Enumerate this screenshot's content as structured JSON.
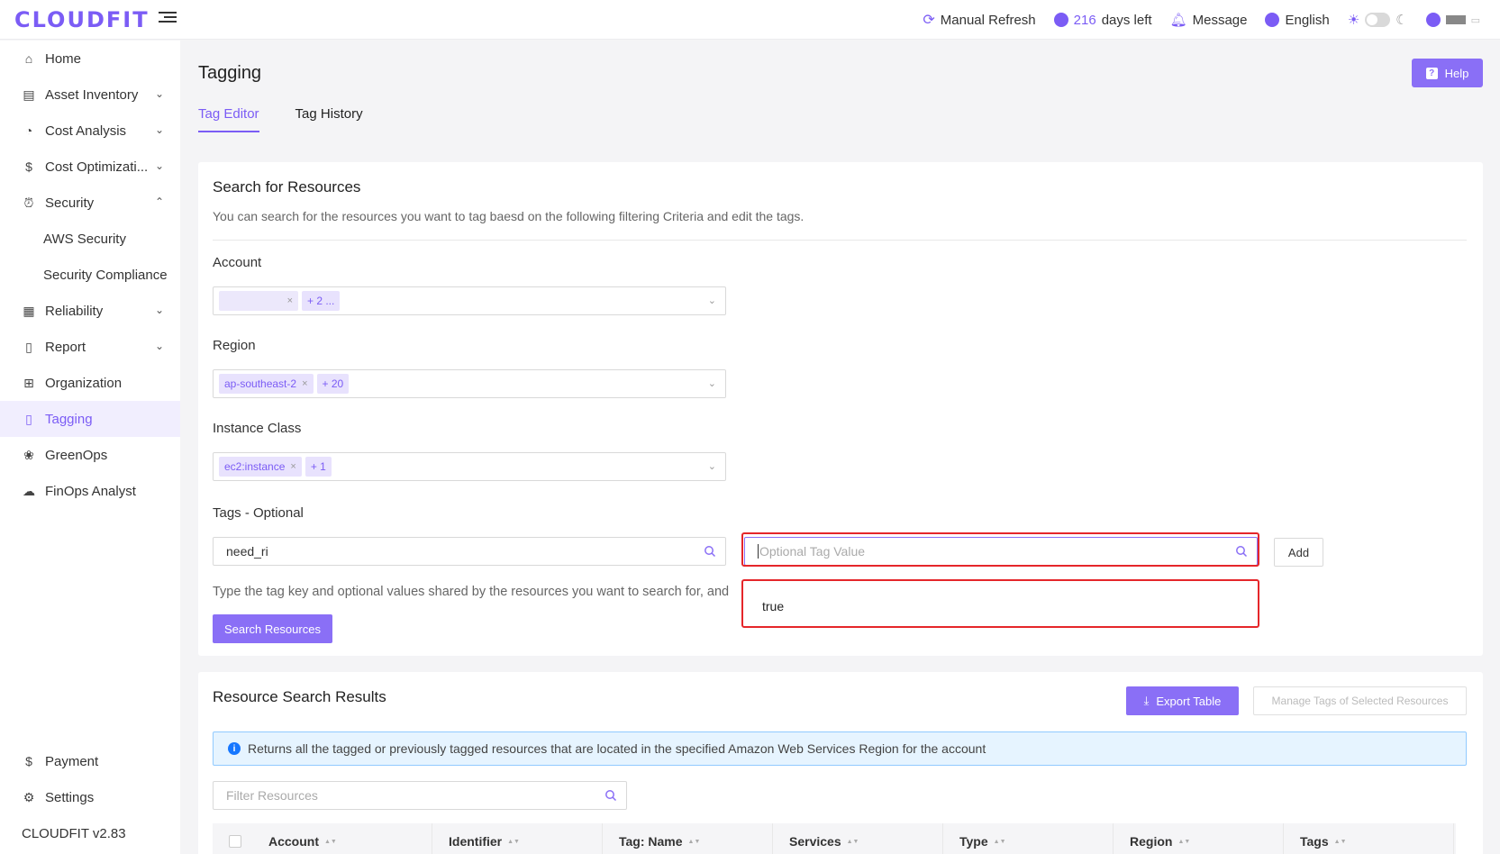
{
  "brand": "CLOUDFIT",
  "topbar": {
    "refresh": "Manual Refresh",
    "days_count": "216",
    "days_suffix": "days left",
    "message": "Message",
    "language": "English"
  },
  "sidebar": {
    "items": [
      {
        "label": "Home"
      },
      {
        "label": "Asset Inventory"
      },
      {
        "label": "Cost Analysis"
      },
      {
        "label": "Cost Optimizati..."
      },
      {
        "label": "Security"
      },
      {
        "label": "AWS Security"
      },
      {
        "label": "Security Compliance"
      },
      {
        "label": "Reliability"
      },
      {
        "label": "Report"
      },
      {
        "label": "Organization"
      },
      {
        "label": "Tagging"
      },
      {
        "label": "GreenOps"
      },
      {
        "label": "FinOps Analyst"
      }
    ],
    "payment": "Payment",
    "settings": "Settings",
    "version": "CLOUDFIT v2.83"
  },
  "page": {
    "title": "Tagging",
    "help": "Help",
    "tabs": [
      "Tag Editor",
      "Tag History"
    ]
  },
  "search": {
    "title": "Search for Resources",
    "description": "You can search for the resources you want to tag baesd on the following filtering Criteria and edit the tags.",
    "account_label": "Account",
    "account_more": "+ 2 ...",
    "region_label": "Region",
    "region_chip": "ap-southeast-2",
    "region_more": "+ 20",
    "class_label": "Instance Class",
    "class_chip": "ec2:instance",
    "class_more": "+ 1",
    "tags_label": "Tags - Optional",
    "tag_key_value": "need_ri",
    "tag_value_placeholder": "Optional Tag Value",
    "add": "Add",
    "hint": "Type the tag key and optional values shared by the resources you want to search for, and",
    "dropdown_option": "true",
    "search_button": "Search Resources"
  },
  "results": {
    "title": "Resource Search Results",
    "export": "Export Table",
    "manage": "Manage Tags of Selected Resources",
    "info": "Returns all the tagged or previously tagged resources that are located in the specified Amazon Web Services Region for the account",
    "filter_placeholder": "Filter Resources",
    "columns": [
      "Account",
      "Identifier",
      "Tag: Name",
      "Services",
      "Type",
      "Region",
      "Tags"
    ]
  },
  "colors": {
    "accent": "#7b5cf5",
    "highlight": "#e5262a",
    "info_bg": "#e6f4ff"
  }
}
